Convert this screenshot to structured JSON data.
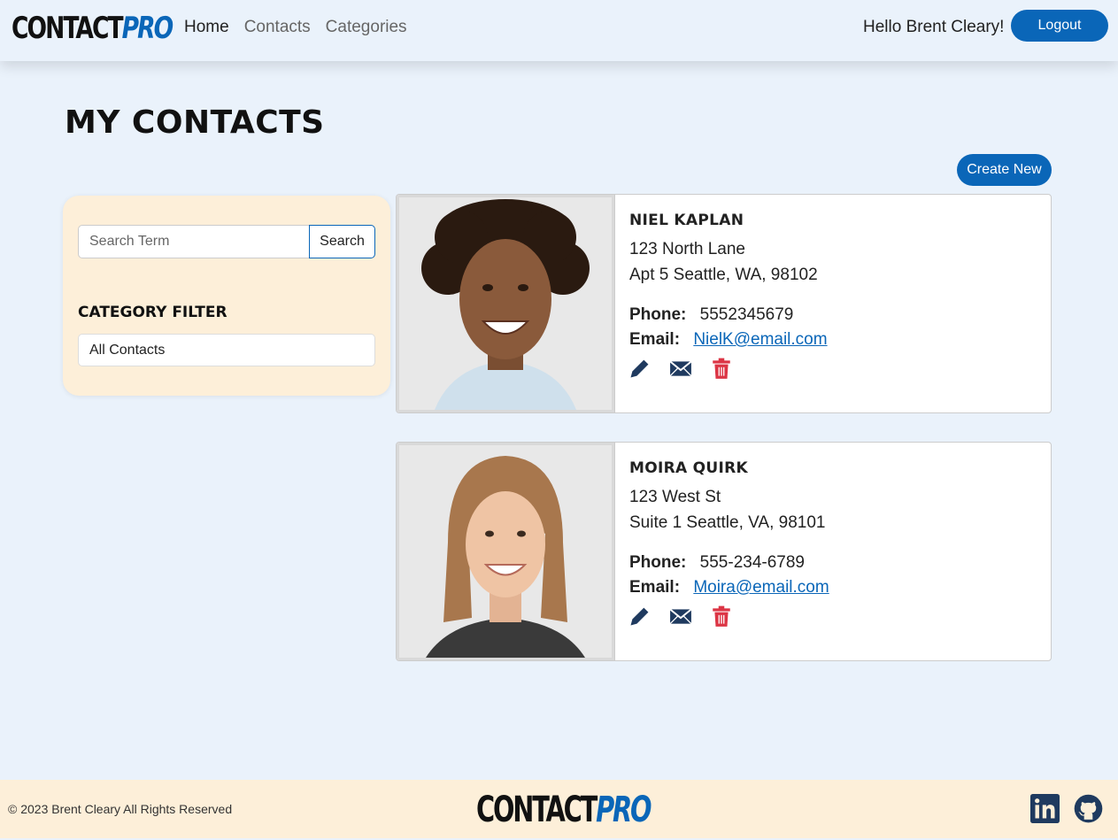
{
  "brand": {
    "part1": "CONTACT",
    "part2": "PRO"
  },
  "nav": {
    "links": [
      {
        "label": "Home"
      },
      {
        "label": "Contacts"
      },
      {
        "label": "Categories"
      }
    ],
    "greeting": "Hello Brent Cleary!",
    "logout_label": "Logout"
  },
  "page": {
    "title": "MY CONTACTS",
    "create_label": "Create New"
  },
  "sidebar": {
    "search_placeholder": "Search Term",
    "search_label": "Search",
    "category_label": "CATEGORY FILTER",
    "category_selected": "All Contacts"
  },
  "contacts": [
    {
      "name": "NIEL KAPLAN",
      "address1": "123 North Lane",
      "address2": "Apt 5 Seattle, WA, 98102",
      "phone_label": "Phone:",
      "phone": "5552345679",
      "email_label": "Email:",
      "email": "NielK@email.com"
    },
    {
      "name": "MOIRA QUIRK",
      "address1": "123 West St",
      "address2": "Suite 1 Seattle, VA, 98101",
      "phone_label": "Phone:",
      "phone": "555-234-6789",
      "email_label": "Email:",
      "email": "Moira@email.com"
    }
  ],
  "icons": {
    "edit": "pencil-icon",
    "email": "envelope-icon",
    "delete": "trash-icon",
    "linkedin": "linkedin-icon",
    "github": "github-icon"
  },
  "colors": {
    "accent": "#0a66b8",
    "background": "#eaf2fb",
    "panel": "#fdefd9",
    "delete": "#dc3545",
    "icon": "#1f3a5f"
  },
  "footer": {
    "copyright": "© 2023 Brent Cleary All Rights Reserved"
  }
}
